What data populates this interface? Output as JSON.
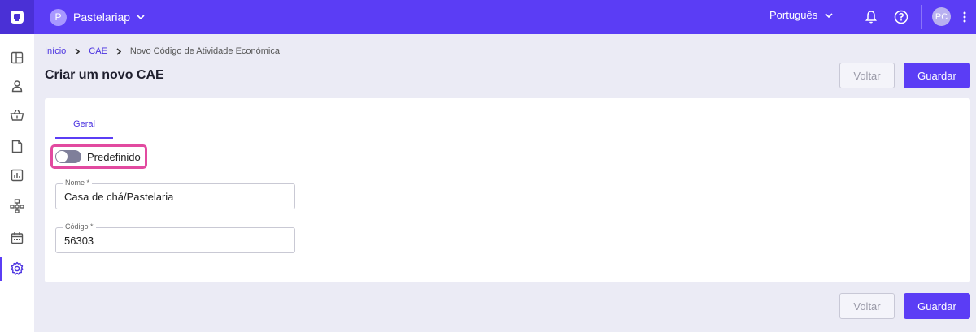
{
  "topbar": {
    "company_initial": "P",
    "company_name": "Pastelariap",
    "language": "Português",
    "user_initials": "PC"
  },
  "sidebar": {
    "items": [
      {
        "icon": "layout-icon"
      },
      {
        "icon": "user-icon"
      },
      {
        "icon": "basket-icon"
      },
      {
        "icon": "document-icon"
      },
      {
        "icon": "chart-icon"
      },
      {
        "icon": "hierarchy-icon"
      },
      {
        "icon": "calendar-icon"
      },
      {
        "icon": "settings-icon",
        "active": true
      }
    ]
  },
  "breadcrumb": {
    "home": "Início",
    "section": "CAE",
    "current": "Novo Código de Atividade Económica"
  },
  "page": {
    "title": "Criar um novo CAE",
    "back_label": "Voltar",
    "save_label": "Guardar"
  },
  "form": {
    "tab_label": "Geral",
    "toggle_label": "Predefinido",
    "toggle_on": false,
    "name": {
      "label": "Nome *",
      "value": "Casa de chá/Pastelaria"
    },
    "code": {
      "label": "Código *",
      "value": "56303"
    }
  },
  "colors": {
    "primary": "#5b3df5",
    "highlight": "#e24aa0",
    "background": "#ebebf5"
  }
}
